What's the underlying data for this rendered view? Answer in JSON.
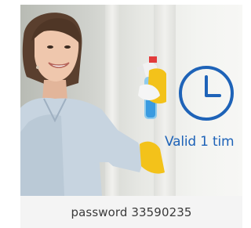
{
  "image": {
    "subject": "woman-cleaning-window",
    "overlay_icon": "clock-icon",
    "overlay_text": "Valid 1 tim",
    "accent_color": "#1e63b8"
  },
  "caption": {
    "text": "password 33590235"
  }
}
